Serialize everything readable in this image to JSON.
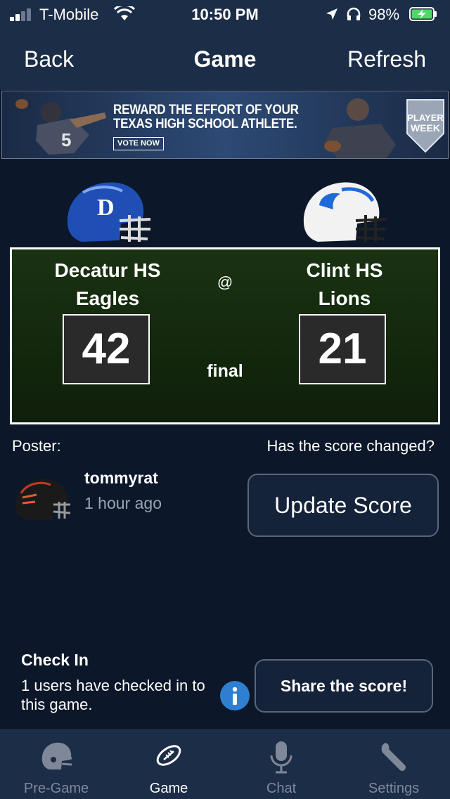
{
  "status_bar": {
    "carrier": "T-Mobile",
    "time": "10:50 PM",
    "battery": "98%",
    "icons": [
      "signal-icon",
      "wifi-icon",
      "location-icon",
      "headphones-icon",
      "battery-charging-icon"
    ]
  },
  "nav": {
    "back": "Back",
    "title": "Game",
    "refresh": "Refresh"
  },
  "banner": {
    "line1": "REWARD THE EFFORT OF YOUR",
    "line2": "TEXAS HIGH SCHOOL ATHLETE.",
    "cta": "VOTE NOW",
    "badge_line1": "PLAYER",
    "badge_line2": "WEEK"
  },
  "game": {
    "home": {
      "school": "Decatur HS",
      "mascot": "Eagles",
      "score": "42",
      "helmet_color": "#1f4fb5"
    },
    "away": {
      "school": "Clint HS",
      "mascot": "Lions",
      "score": "21",
      "helmet_color": "#f2f2f2"
    },
    "separator": "@",
    "status": "final"
  },
  "poster": {
    "label": "Poster:",
    "username": "tommyrat",
    "time_ago": "1 hour ago"
  },
  "score_prompt": "Has the score changed?",
  "update_button": "Update Score",
  "checkin": {
    "title": "Check In",
    "text": "1 users have checked in to this game.",
    "share_button": "Share the score!"
  },
  "tabs": [
    {
      "label": "Pre-Game",
      "icon": "helmet-icon",
      "active": false
    },
    {
      "label": "Game",
      "icon": "football-icon",
      "active": true
    },
    {
      "label": "Chat",
      "icon": "microphone-icon",
      "active": false
    },
    {
      "label": "Settings",
      "icon": "wrench-icon",
      "active": false
    }
  ],
  "colors": {
    "background": "#0c1729",
    "header": "#1c2d47",
    "scoreboard": "#1a3212",
    "info_icon": "#2f7fd0"
  }
}
